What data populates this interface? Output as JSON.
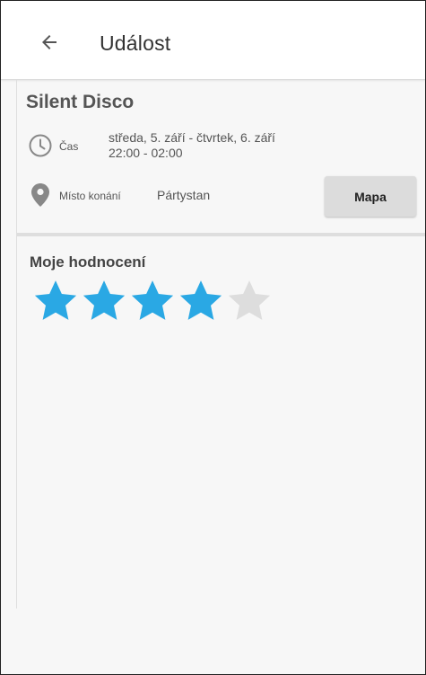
{
  "header": {
    "title": "Událost",
    "back_icon": "arrow-left-icon"
  },
  "event": {
    "name": "Silent Disco",
    "time": {
      "icon": "clock-icon",
      "label": "Čas",
      "dates": "středa, 5. září - čtvrtek, 6. září",
      "hours": "22:00 - 02:00"
    },
    "place": {
      "icon": "map-pin-icon",
      "label": "Místo konání",
      "value": "Pártystan",
      "map_button_label": "Mapa"
    }
  },
  "rating": {
    "label": "Moje hodnocení",
    "value": 4,
    "max": 5,
    "filled_color": "#2aa8e4",
    "empty_color": "#dddddd"
  }
}
